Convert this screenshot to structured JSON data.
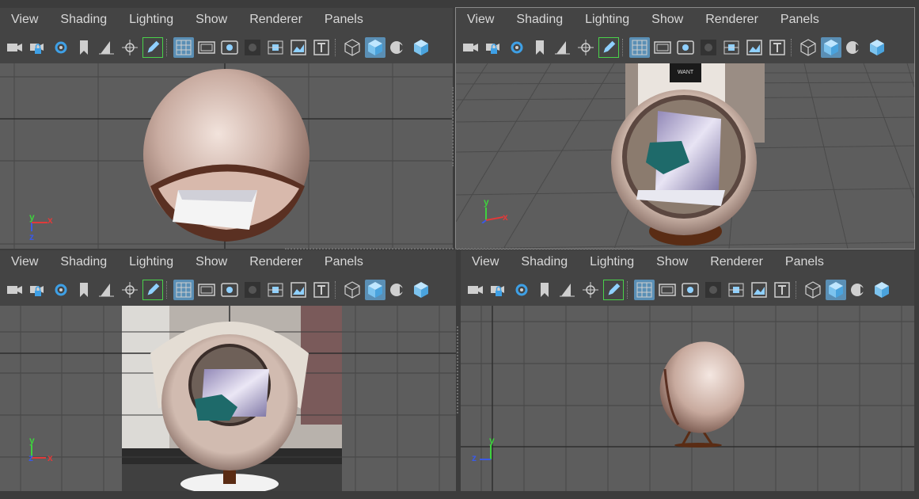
{
  "menu": [
    "View",
    "Shading",
    "Lighting",
    "Show",
    "Renderer",
    "Panels"
  ],
  "toolbar_icons": [
    "camera-icon",
    "camera-lock-icon",
    "camera-attributes-icon",
    "bookmark-icon",
    "image-plane-icon",
    "pivot-icon",
    "pencil-icon",
    "grid-icon",
    "film-gate-icon",
    "resolution-gate-icon",
    "gate-mask-icon",
    "field-chart-icon",
    "safe-area-icon",
    "safe-title-icon",
    "wireframe-icon",
    "smooth-shade-icon",
    "use-lights-icon",
    "xray-icon"
  ],
  "panels": {
    "top": {
      "axis": {
        "y": "y",
        "x": "x",
        "z": "z"
      }
    },
    "persp": {
      "axis": {
        "y": "y",
        "x": "x"
      },
      "poster_text": "WANT"
    },
    "front": {
      "axis": {
        "y": "y",
        "z": "z",
        "x": "x"
      }
    },
    "side": {
      "axis": {
        "y": "y",
        "z": "z"
      }
    }
  },
  "colors": {
    "viewport": "#5d5d5d",
    "grid": "#4a4a4a",
    "icon_active": "#5a8fb5",
    "pencil_frame": "#4ad24a",
    "cushion": "#1e6a6a",
    "shell": "#d9c4ba",
    "base": "#5a2c14"
  }
}
